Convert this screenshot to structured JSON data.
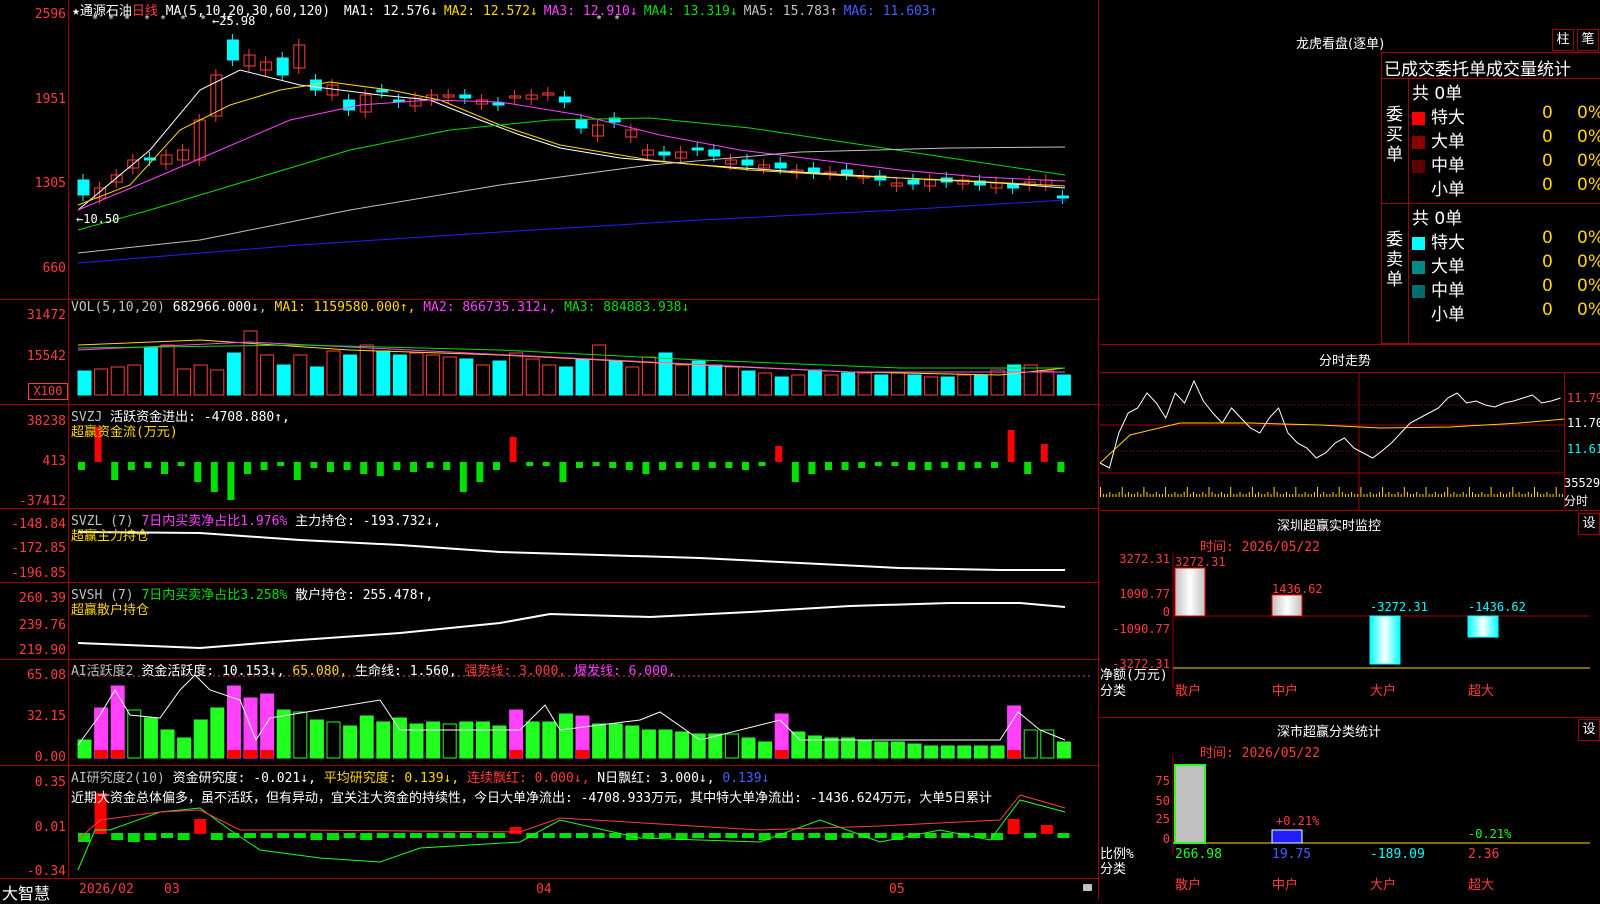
{
  "stock": {
    "star": "★",
    "name": "通源石油",
    "period": "日线",
    "ma_params": "MA(5,10,20,30,60,120)",
    "ma": [
      {
        "label": "MA1:",
        "value": "12.576↓",
        "color": "#ffffff"
      },
      {
        "label": "MA2:",
        "value": "12.572↓",
        "color": "#ffd700"
      },
      {
        "label": "MA3:",
        "value": "12.910↓",
        "color": "#ff40ff"
      },
      {
        "label": "MA4:",
        "value": "13.319↓",
        "color": "#00e000"
      },
      {
        "label": "MA5:",
        "value": "15.783↑",
        "color": "#c0c0c0"
      },
      {
        "label": "MA6:",
        "value": "11.603↑",
        "color": "#4060ff"
      }
    ],
    "high_mark": "25.98",
    "low_mark": "10.50",
    "price_axis": [
      "2596",
      "1951",
      "1305",
      "660"
    ]
  },
  "vol": {
    "header": "VOL(5,10,20)",
    "value": "682966.000↓",
    "ma1": "MA1: 1159580.000↑",
    "ma2": "MA2: 866735.312↓",
    "ma3": "MA3: 884883.938↓",
    "axis": [
      "31472",
      "15542"
    ],
    "unit": "X100"
  },
  "svzj": {
    "name": "SVZJ",
    "desc": "活跃资金进出: -4708.880↑,",
    "sub": "超赢资金流(万元)",
    "axis": [
      "38238",
      "413",
      "-37412"
    ]
  },
  "svzl": {
    "name": "SVZL (7)",
    "desc": "7日内买卖净占比1.976%",
    "pos": "主力持仓: -193.732↓,",
    "sub": "超赢主力持仓",
    "axis": [
      "-148.84",
      "-172.85",
      "-196.85"
    ]
  },
  "svsh": {
    "name": "SVSH (7)",
    "desc": "7日内买卖净占比3.258%",
    "pos": "散户持仓: 255.478↑,",
    "sub": "超赢散户持仓",
    "axis": [
      "260.39",
      "239.76",
      "219.90"
    ]
  },
  "ai1": {
    "name": "AI活跃度2",
    "t1": "资金活跃度: 10.153↓,",
    "t2": "65.080,",
    "t3": "生命线: 1.560,",
    "t4": "强势线: 3.000,",
    "t5": "爆发线: 6.000,",
    "axis": [
      "65.08",
      "32.15",
      "0.00"
    ]
  },
  "ai2": {
    "name": "AI研究度2(10)",
    "t1": "资金研究度: -0.021↓,",
    "t2": "平均研究度: 0.139↓,",
    "t3": "连续飘红: 0.000↓,",
    "t4": "N日飘红: 3.000↓,",
    "t5": "0.139↓",
    "comment": "近期大资金总体偏多，虽不活跃，但有异动，宜关注大资金的持续性，今日大单净流出: -4708.933万元，其中特大单净流出: -1436.624万元，大单5日累计",
    "axis": [
      "0.35",
      "0.01",
      "-0.34"
    ]
  },
  "dates": {
    "logo": "大智慧",
    "d1": "2026/02",
    "d2": "03",
    "d3": "04",
    "d4": "05"
  },
  "lhb": {
    "title": "龙虎看盘(逐单)",
    "btn1": "柱",
    "btn2": "笔",
    "head": "已成交委托单成交量统计",
    "buy": {
      "label": "委买单",
      "total": "共 0单",
      "rows": [
        {
          "name": "特大",
          "v": "0",
          "p": "0%",
          "c": "#ff0000"
        },
        {
          "name": "大单",
          "v": "0",
          "p": "0%",
          "c": "#8b0000"
        },
        {
          "name": "中单",
          "v": "0",
          "p": "0%",
          "c": "#600000"
        },
        {
          "name": "小单",
          "v": "0",
          "p": "0%",
          "c": "#000000"
        }
      ]
    },
    "sell": {
      "label": "委卖单",
      "total": "共 0单",
      "rows": [
        {
          "name": "特大",
          "v": "0",
          "p": "0%",
          "c": "#00ffff"
        },
        {
          "name": "大单",
          "v": "0",
          "p": "0%",
          "c": "#008b8b"
        },
        {
          "name": "中单",
          "v": "0",
          "p": "0%",
          "c": "#006d6d"
        },
        {
          "name": "小单",
          "v": "0",
          "p": "0%",
          "c": "#000000"
        }
      ]
    }
  },
  "fenshi": {
    "title": "分时走势",
    "p1": "11.79",
    "p2": "11.70",
    "p3": "11.61",
    "vol": "35529",
    "unit": "分时"
  },
  "monitor": {
    "title": "深圳超赢实时监控",
    "btn": "设",
    "time": "时间: 2026/05/22",
    "axis": [
      "3272.31",
      "1090.77",
      "0",
      "-1090.77",
      "-3272.31"
    ],
    "bars": [
      {
        "label": "3272.31",
        "value": 3272.31
      },
      {
        "label": "1436.62",
        "value": 1436.62
      },
      {
        "label": "-3272.31",
        "value": -3272.31
      },
      {
        "label": "-1436.62",
        "value": -1436.62
      }
    ],
    "net_label": "净额(万元)",
    "cat_label": "分类",
    "cats": [
      "散户",
      "中户",
      "大户",
      "超大"
    ]
  },
  "classify": {
    "title": "深市超赢分类统计",
    "btn": "设",
    "time": "时间: 2026/05/22",
    "axis": [
      "75",
      "50",
      "25",
      "0"
    ],
    "pct1": "+0.21%",
    "pct2": "-0.21%",
    "vals": [
      "266.98",
      "19.75",
      "-189.09",
      "2.36"
    ],
    "ratio_label": "比例%",
    "cat_label": "分类",
    "cats": [
      "散户",
      "中户",
      "大户",
      "超大"
    ]
  }
}
